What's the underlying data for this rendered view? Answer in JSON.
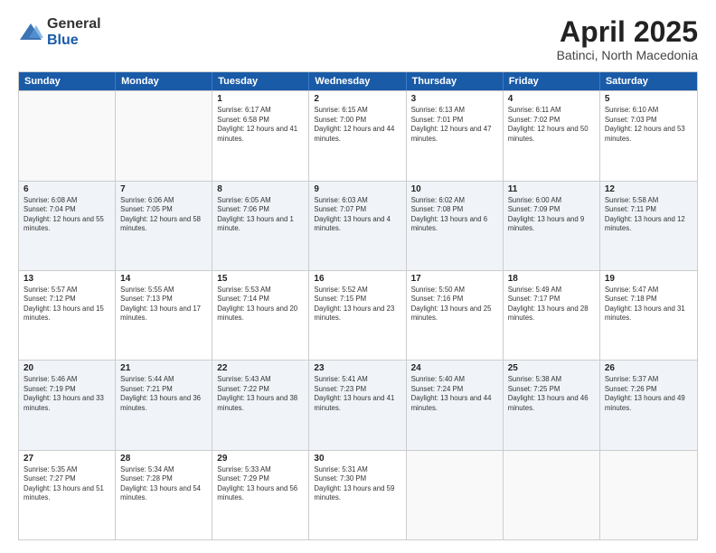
{
  "logo": {
    "general": "General",
    "blue": "Blue"
  },
  "title": "April 2025",
  "subtitle": "Batinci, North Macedonia",
  "days": [
    "Sunday",
    "Monday",
    "Tuesday",
    "Wednesday",
    "Thursday",
    "Friday",
    "Saturday"
  ],
  "weeks": [
    [
      {
        "day": "",
        "sunrise": "",
        "sunset": "",
        "daylight": ""
      },
      {
        "day": "",
        "sunrise": "",
        "sunset": "",
        "daylight": ""
      },
      {
        "day": "1",
        "sunrise": "Sunrise: 6:17 AM",
        "sunset": "Sunset: 6:58 PM",
        "daylight": "Daylight: 12 hours and 41 minutes."
      },
      {
        "day": "2",
        "sunrise": "Sunrise: 6:15 AM",
        "sunset": "Sunset: 7:00 PM",
        "daylight": "Daylight: 12 hours and 44 minutes."
      },
      {
        "day": "3",
        "sunrise": "Sunrise: 6:13 AM",
        "sunset": "Sunset: 7:01 PM",
        "daylight": "Daylight: 12 hours and 47 minutes."
      },
      {
        "day": "4",
        "sunrise": "Sunrise: 6:11 AM",
        "sunset": "Sunset: 7:02 PM",
        "daylight": "Daylight: 12 hours and 50 minutes."
      },
      {
        "day": "5",
        "sunrise": "Sunrise: 6:10 AM",
        "sunset": "Sunset: 7:03 PM",
        "daylight": "Daylight: 12 hours and 53 minutes."
      }
    ],
    [
      {
        "day": "6",
        "sunrise": "Sunrise: 6:08 AM",
        "sunset": "Sunset: 7:04 PM",
        "daylight": "Daylight: 12 hours and 55 minutes."
      },
      {
        "day": "7",
        "sunrise": "Sunrise: 6:06 AM",
        "sunset": "Sunset: 7:05 PM",
        "daylight": "Daylight: 12 hours and 58 minutes."
      },
      {
        "day": "8",
        "sunrise": "Sunrise: 6:05 AM",
        "sunset": "Sunset: 7:06 PM",
        "daylight": "Daylight: 13 hours and 1 minute."
      },
      {
        "day": "9",
        "sunrise": "Sunrise: 6:03 AM",
        "sunset": "Sunset: 7:07 PM",
        "daylight": "Daylight: 13 hours and 4 minutes."
      },
      {
        "day": "10",
        "sunrise": "Sunrise: 6:02 AM",
        "sunset": "Sunset: 7:08 PM",
        "daylight": "Daylight: 13 hours and 6 minutes."
      },
      {
        "day": "11",
        "sunrise": "Sunrise: 6:00 AM",
        "sunset": "Sunset: 7:09 PM",
        "daylight": "Daylight: 13 hours and 9 minutes."
      },
      {
        "day": "12",
        "sunrise": "Sunrise: 5:58 AM",
        "sunset": "Sunset: 7:11 PM",
        "daylight": "Daylight: 13 hours and 12 minutes."
      }
    ],
    [
      {
        "day": "13",
        "sunrise": "Sunrise: 5:57 AM",
        "sunset": "Sunset: 7:12 PM",
        "daylight": "Daylight: 13 hours and 15 minutes."
      },
      {
        "day": "14",
        "sunrise": "Sunrise: 5:55 AM",
        "sunset": "Sunset: 7:13 PM",
        "daylight": "Daylight: 13 hours and 17 minutes."
      },
      {
        "day": "15",
        "sunrise": "Sunrise: 5:53 AM",
        "sunset": "Sunset: 7:14 PM",
        "daylight": "Daylight: 13 hours and 20 minutes."
      },
      {
        "day": "16",
        "sunrise": "Sunrise: 5:52 AM",
        "sunset": "Sunset: 7:15 PM",
        "daylight": "Daylight: 13 hours and 23 minutes."
      },
      {
        "day": "17",
        "sunrise": "Sunrise: 5:50 AM",
        "sunset": "Sunset: 7:16 PM",
        "daylight": "Daylight: 13 hours and 25 minutes."
      },
      {
        "day": "18",
        "sunrise": "Sunrise: 5:49 AM",
        "sunset": "Sunset: 7:17 PM",
        "daylight": "Daylight: 13 hours and 28 minutes."
      },
      {
        "day": "19",
        "sunrise": "Sunrise: 5:47 AM",
        "sunset": "Sunset: 7:18 PM",
        "daylight": "Daylight: 13 hours and 31 minutes."
      }
    ],
    [
      {
        "day": "20",
        "sunrise": "Sunrise: 5:46 AM",
        "sunset": "Sunset: 7:19 PM",
        "daylight": "Daylight: 13 hours and 33 minutes."
      },
      {
        "day": "21",
        "sunrise": "Sunrise: 5:44 AM",
        "sunset": "Sunset: 7:21 PM",
        "daylight": "Daylight: 13 hours and 36 minutes."
      },
      {
        "day": "22",
        "sunrise": "Sunrise: 5:43 AM",
        "sunset": "Sunset: 7:22 PM",
        "daylight": "Daylight: 13 hours and 38 minutes."
      },
      {
        "day": "23",
        "sunrise": "Sunrise: 5:41 AM",
        "sunset": "Sunset: 7:23 PM",
        "daylight": "Daylight: 13 hours and 41 minutes."
      },
      {
        "day": "24",
        "sunrise": "Sunrise: 5:40 AM",
        "sunset": "Sunset: 7:24 PM",
        "daylight": "Daylight: 13 hours and 44 minutes."
      },
      {
        "day": "25",
        "sunrise": "Sunrise: 5:38 AM",
        "sunset": "Sunset: 7:25 PM",
        "daylight": "Daylight: 13 hours and 46 minutes."
      },
      {
        "day": "26",
        "sunrise": "Sunrise: 5:37 AM",
        "sunset": "Sunset: 7:26 PM",
        "daylight": "Daylight: 13 hours and 49 minutes."
      }
    ],
    [
      {
        "day": "27",
        "sunrise": "Sunrise: 5:35 AM",
        "sunset": "Sunset: 7:27 PM",
        "daylight": "Daylight: 13 hours and 51 minutes."
      },
      {
        "day": "28",
        "sunrise": "Sunrise: 5:34 AM",
        "sunset": "Sunset: 7:28 PM",
        "daylight": "Daylight: 13 hours and 54 minutes."
      },
      {
        "day": "29",
        "sunrise": "Sunrise: 5:33 AM",
        "sunset": "Sunset: 7:29 PM",
        "daylight": "Daylight: 13 hours and 56 minutes."
      },
      {
        "day": "30",
        "sunrise": "Sunrise: 5:31 AM",
        "sunset": "Sunset: 7:30 PM",
        "daylight": "Daylight: 13 hours and 59 minutes."
      },
      {
        "day": "",
        "sunrise": "",
        "sunset": "",
        "daylight": ""
      },
      {
        "day": "",
        "sunrise": "",
        "sunset": "",
        "daylight": ""
      },
      {
        "day": "",
        "sunrise": "",
        "sunset": "",
        "daylight": ""
      }
    ]
  ]
}
